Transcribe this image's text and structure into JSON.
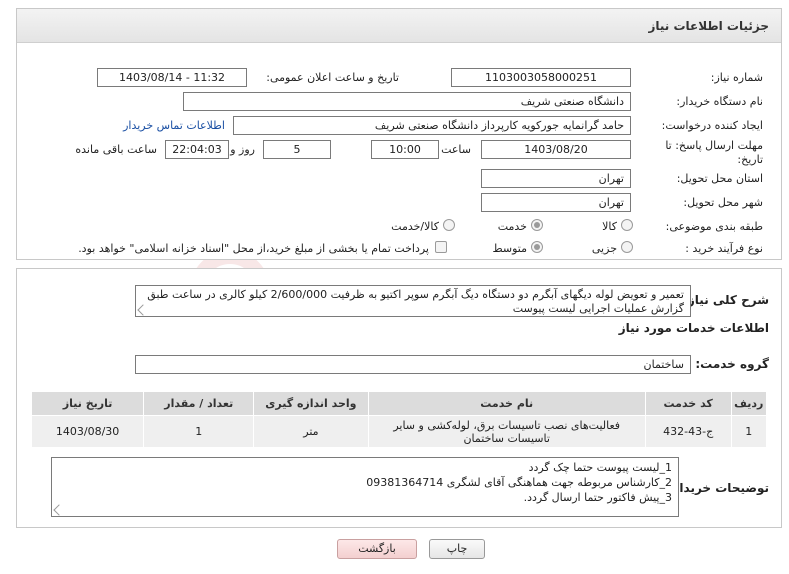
{
  "header": {
    "title": "جزئیات اطلاعات نیاز"
  },
  "form": {
    "need_number": {
      "label": "شماره نیاز:",
      "value": "1103003058000251"
    },
    "announce_datetime": {
      "label": "تاریخ و ساعت اعلان عمومی:",
      "value": "1403/08/14 - 11:32"
    },
    "buyer_org": {
      "label": "نام دستگاه خریدار:",
      "value": "دانشگاه صنعتی شریف"
    },
    "requester": {
      "label": "ایجاد کننده درخواست:",
      "value": "حامد گرانمایه جورکویه کارپرداز دانشگاه صنعتی شریف",
      "contact_link": "اطلاعات تماس خریدار"
    },
    "deadline": {
      "label_line1": "مهلت ارسال پاسخ: تا",
      "label_line2": "تاریخ:",
      "date": "1403/08/20",
      "time_label": "ساعت",
      "time": "10:00",
      "days": "5",
      "days_label": "روز و",
      "remaining": "22:04:03",
      "remaining_label": "ساعت باقی مانده"
    },
    "province": {
      "label": "استان محل تحویل:",
      "value": "تهران"
    },
    "city": {
      "label": "شهر محل تحویل:",
      "value": "تهران"
    },
    "category": {
      "label": "طبقه بندی موضوعی:",
      "options": [
        "کالا",
        "خدمت",
        "کالا/خدمت"
      ]
    },
    "purchase_type": {
      "label": "نوع فرآیند خرید :",
      "options": [
        "جزیی",
        "متوسط"
      ],
      "payment_note": "پرداخت تمام یا بخشی از مبلغ خرید،از محل \"اسناد خزانه اسلامی\" خواهد بود."
    }
  },
  "need_summary": {
    "label": "شرح کلی نیاز:",
    "text": "تعمیر و تعویض لوله دیگهای آبگرم دو دستگاه دیگ آبگرم سوپر اکتیو به ظرفیت 2/600/000 کیلو کالری در ساعت طبق گزارش عملیات اجرایی لیست پیوست"
  },
  "services": {
    "section_title": "اطلاعات خدمات مورد نیاز",
    "group_label": "گروه خدمت:",
    "group_value": "ساختمان",
    "columns": [
      "ردیف",
      "کد خدمت",
      "نام خدمت",
      "واحد اندازه گیری",
      "تعداد / مقدار",
      "تاریخ نیاز"
    ],
    "rows": [
      [
        "1",
        "ج-43-432",
        "فعالیت‌های نصب تاسیسات برق، لوله‌کشی و سایر تاسیسات ساختمان",
        "متر",
        "1",
        "1403/08/30"
      ]
    ]
  },
  "buyer_notes": {
    "label": "توضیحات خریدار:",
    "lines": [
      "1_لیست پیوست حتما چک گردد",
      "2_کارشناس مربوطه جهت هماهنگی آقای لشگری 09381364714",
      "3_پیش فاکتور حتما ارسال گردد."
    ]
  },
  "actions": {
    "print": "چاپ",
    "back": "بازگشت"
  },
  "colors": {
    "link": "#1a4fa3",
    "watermark": "#c83c3c"
  }
}
